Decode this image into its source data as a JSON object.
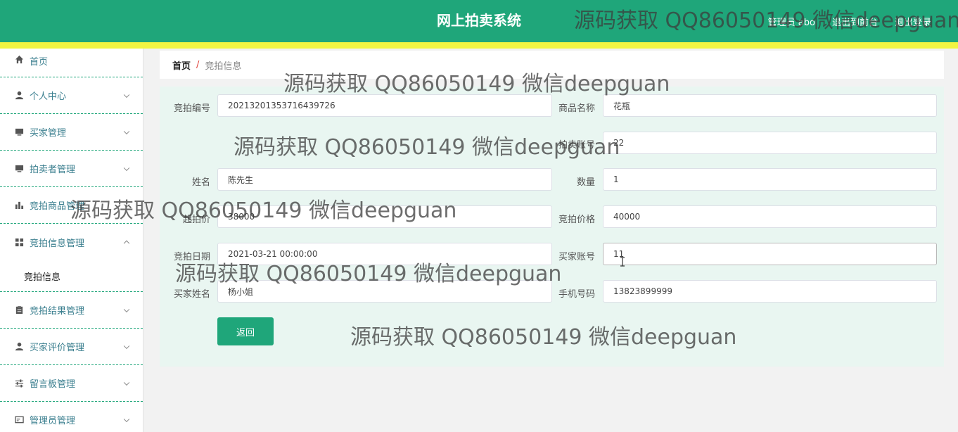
{
  "header": {
    "title": "网上拍卖系统",
    "admin_label": "管理员 abo",
    "back_home": "退出到前台",
    "logout": "退出登录"
  },
  "sidebar": {
    "items": [
      {
        "label": "首页",
        "icon": "home-icon"
      },
      {
        "label": "个人中心",
        "icon": "user-icon"
      },
      {
        "label": "买家管理",
        "icon": "monitor-icon"
      },
      {
        "label": "拍卖者管理",
        "icon": "monitor-icon"
      },
      {
        "label": "竞拍商品管理",
        "icon": "bar-chart-icon"
      },
      {
        "label": "竞拍信息管理",
        "icon": "grid-icon"
      },
      {
        "label": "竞拍结果管理",
        "icon": "clipboard-icon"
      },
      {
        "label": "买家评价管理",
        "icon": "user-icon"
      },
      {
        "label": "留言板管理",
        "icon": "sliders-icon"
      },
      {
        "label": "管理员管理",
        "icon": "card-icon"
      }
    ],
    "submenu_label": "竞拍信息"
  },
  "breadcrumb": {
    "home": "首页",
    "separator": "/",
    "current": "竞拍信息"
  },
  "form": {
    "fields": [
      {
        "label": "竞拍编号",
        "value": "20213201353716439726"
      },
      {
        "label": "商品名称",
        "value": "花瓶"
      },
      {
        "label": "拍卖账号",
        "value": "22"
      },
      {
        "label": "姓名",
        "value": "陈先生"
      },
      {
        "label": "数量",
        "value": "1"
      },
      {
        "label": "起拍价",
        "value": "38000"
      },
      {
        "label": "竞拍价格",
        "value": "40000"
      },
      {
        "label": "竞拍日期",
        "value": "2021-03-21 00:00:00"
      },
      {
        "label": "买家账号",
        "value": "11"
      },
      {
        "label": "买家姓名",
        "value": "杨小姐"
      },
      {
        "label": "手机号码",
        "value": "13823899999"
      }
    ],
    "back_button": "返回"
  },
  "watermark": "源码获取 QQ86050149 微信deepguan",
  "colors": {
    "primary": "#1fa67a",
    "accent_bar": "#f2f542",
    "panel_bg": "#e9f6f1"
  }
}
